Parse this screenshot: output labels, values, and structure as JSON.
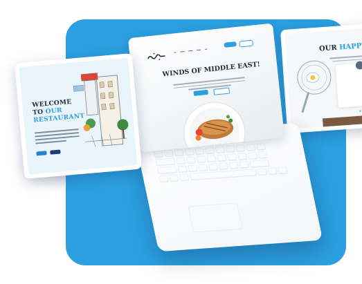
{
  "colors": {
    "accent": "#2b9fe0",
    "tile_background": "#2b9fe0",
    "heading": "#1d2b3e"
  },
  "left_card": {
    "title_line1": "WELCOME",
    "title_line2_prefix": "TO",
    "title_line2_accent": "OUR",
    "title_line3": "RESTAURANT",
    "illustration": "city-street-sketch"
  },
  "laptop": {
    "brand_logo": "arabic-script-logo",
    "hero_title": "WINDS OF MIDDLE EAST!",
    "hero_image": "grilled-chicken-plate"
  },
  "right_card": {
    "title_prefix": "OUR",
    "title_accent": "HAPPY CU",
    "illustration": "frying-pan-sketch"
  }
}
